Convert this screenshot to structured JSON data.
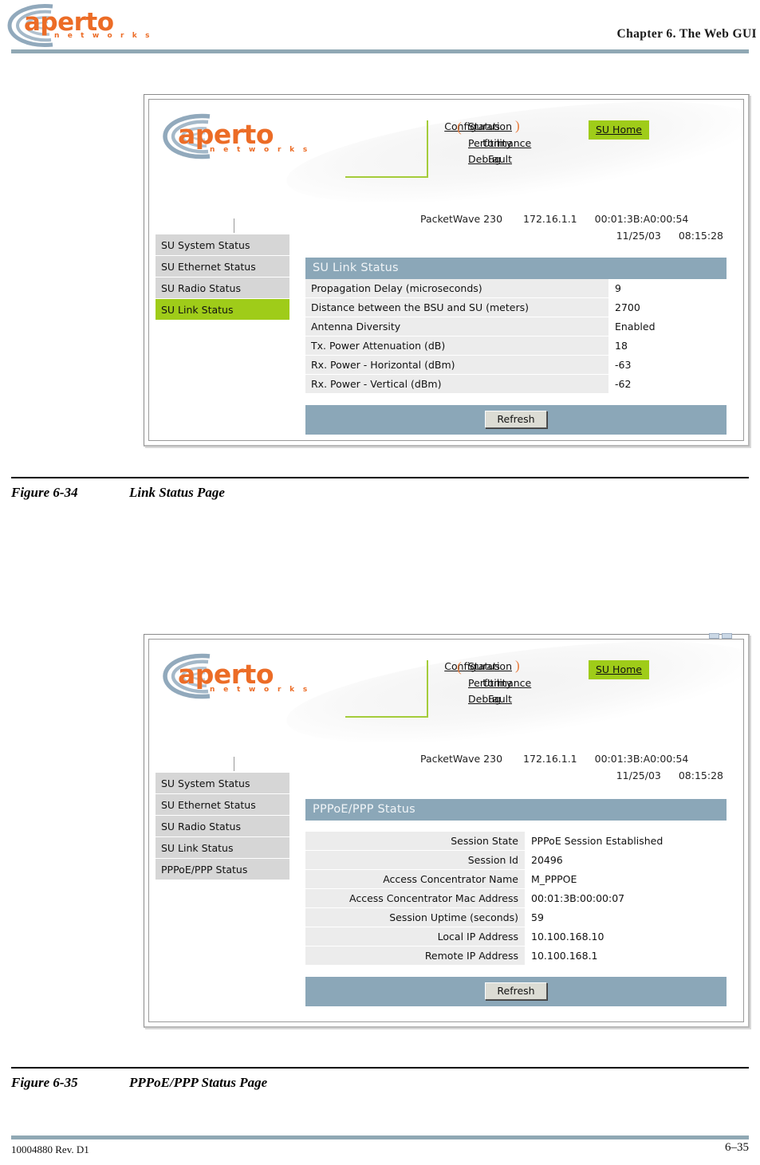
{
  "page": {
    "brand_name": "aperto",
    "brand_tagline": "n e t w o r k s",
    "chapter_title": "Chapter 6.  The Web GUI",
    "footer_doc_id": "10004880 Rev. D1",
    "footer_page": "6–35",
    "colors": {
      "brand_orange": "#ec6c26",
      "swirl_blue": "#7e9ab0",
      "rule_blue": "#90a8b4",
      "panel_header": "#8ba7b8",
      "highlight_green": "#9fcc19",
      "sidebar_grey": "#d6d6d6",
      "label_cell_grey": "#ececec"
    }
  },
  "figures": [
    {
      "id": "figure-6-34",
      "number": "Figure 6-34",
      "label": "Link Status Page",
      "gui": {
        "nav_left": [
          {
            "label": "Configuration",
            "name": "nav-configuration"
          },
          {
            "label": "Utility",
            "name": "nav-utility"
          },
          {
            "label": "Fault",
            "name": "nav-fault"
          }
        ],
        "nav_right": [
          {
            "label": "Status",
            "name": "nav-status",
            "selected": true
          },
          {
            "label": "Performance",
            "name": "nav-performance"
          },
          {
            "label": "Debug",
            "name": "nav-debug"
          }
        ],
        "su_home": "SU Home",
        "device": {
          "model": "PacketWave 230",
          "ip": "172.16.1.1",
          "mac": "00:01:3B:A0:00:54",
          "date": "11/25/03",
          "time": "08:15:28"
        },
        "sidebar": [
          {
            "label": "SU System Status",
            "active": false
          },
          {
            "label": "SU Ethernet Status",
            "active": false
          },
          {
            "label": "SU Radio Status",
            "active": false
          },
          {
            "label": "SU Link Status",
            "active": true
          }
        ],
        "panel_title": "SU Link Status",
        "label_align": "left",
        "rows": [
          {
            "key": "Propagation Delay (microseconds)",
            "value": "9"
          },
          {
            "key": "Distance between the BSU and SU (meters)",
            "value": "2700"
          },
          {
            "key": "Antenna Diversity",
            "value": "Enabled"
          },
          {
            "key": "Tx. Power Attenuation (dB)",
            "value": "18"
          },
          {
            "key": "Rx. Power - Horizontal (dBm)",
            "value": "-63"
          },
          {
            "key": "Rx. Power - Vertical (dBm)",
            "value": "-62"
          }
        ],
        "refresh_label": "Refresh",
        "has_window_controls": false
      }
    },
    {
      "id": "figure-6-35",
      "number": "Figure 6-35",
      "label": "PPPoE/PPP Status Page",
      "gui": {
        "nav_left": [
          {
            "label": "Configuration",
            "name": "nav-configuration"
          },
          {
            "label": "Utility",
            "name": "nav-utility"
          },
          {
            "label": "Fault",
            "name": "nav-fault"
          }
        ],
        "nav_right": [
          {
            "label": "Status",
            "name": "nav-status",
            "selected": true
          },
          {
            "label": "Performance",
            "name": "nav-performance"
          },
          {
            "label": "Debug",
            "name": "nav-debug"
          }
        ],
        "su_home": "SU Home",
        "device": {
          "model": "PacketWave 230",
          "ip": "172.16.1.1",
          "mac": "00:01:3B:A0:00:54",
          "date": "11/25/03",
          "time": "08:15:28"
        },
        "sidebar": [
          {
            "label": "SU System Status",
            "active": false
          },
          {
            "label": "SU Ethernet Status",
            "active": false
          },
          {
            "label": "SU Radio Status",
            "active": false
          },
          {
            "label": "SU Link Status",
            "active": false
          },
          {
            "label": "PPPoE/PPP Status",
            "active": false
          }
        ],
        "panel_title": "PPPoE/PPP Status",
        "label_align": "right",
        "rows": [
          {
            "key": "Session State",
            "value": "PPPoE Session Established"
          },
          {
            "key": "Session Id",
            "value": "20496"
          },
          {
            "key": "Access Concentrator Name",
            "value": "M_PPPOE"
          },
          {
            "key": "Access Concentrator Mac Address",
            "value": "00:01:3B:00:00:07"
          },
          {
            "key": "Session Uptime (seconds)",
            "value": "59"
          },
          {
            "key": "Local IP Address",
            "value": "10.100.168.10"
          },
          {
            "key": "Remote IP Address",
            "value": "10.100.168.1"
          }
        ],
        "refresh_label": "Refresh",
        "has_window_controls": true
      }
    }
  ]
}
